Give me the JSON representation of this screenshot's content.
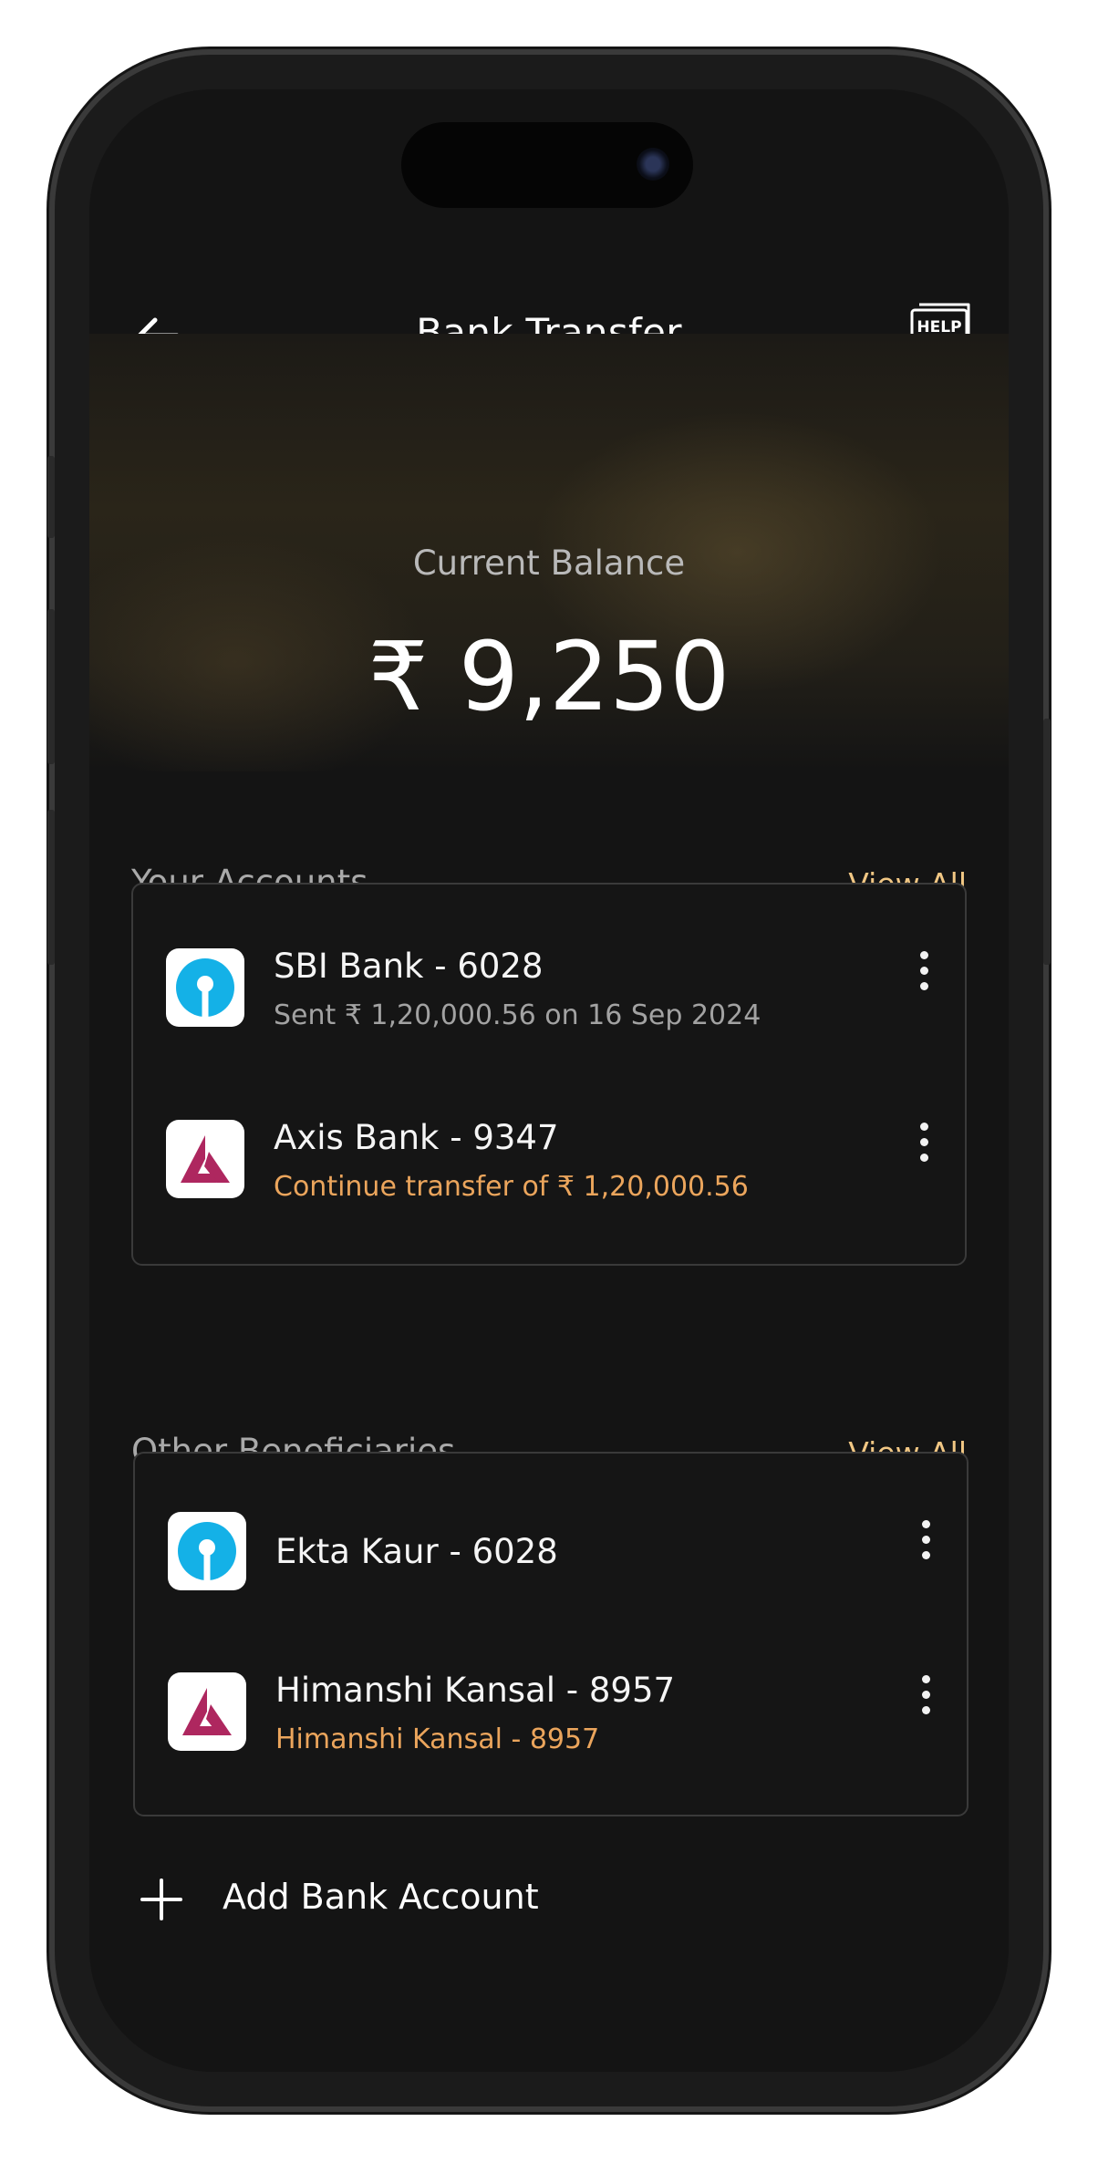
{
  "header": {
    "title": "Bank Transfer",
    "help_label": "HELP"
  },
  "balance": {
    "label": "Current Balance",
    "amount": "₹ 9,250"
  },
  "your_accounts": {
    "title": "Your Accounts",
    "view_all": "View All",
    "items": [
      {
        "name": "SBI Bank - 6028",
        "detail": "Sent ₹ 1,20,000.56 on 16 Sep 2024",
        "logo": "sbi-logo"
      },
      {
        "name": "Axis Bank - 9347",
        "detail": "Continue transfer of ₹ 1,20,000.56",
        "logo": "axis-logo"
      }
    ]
  },
  "other_beneficiaries": {
    "title": "Other Beneficiaries",
    "view_all": "View All",
    "items": [
      {
        "name": "Ekta Kaur - 6028",
        "logo": "sbi-logo"
      },
      {
        "name": "Himanshi Kansal - 8957",
        "detail": "Himanshi Kansal - 8957",
        "logo": "axis-logo"
      }
    ]
  },
  "add_account": {
    "label": "Add Bank Account"
  },
  "colors": {
    "accent": "#f1c784",
    "highlight": "#eba55c",
    "background": "#141414",
    "sbi_blue": "#14b1e7",
    "axis_maroon": "#ae275f"
  }
}
